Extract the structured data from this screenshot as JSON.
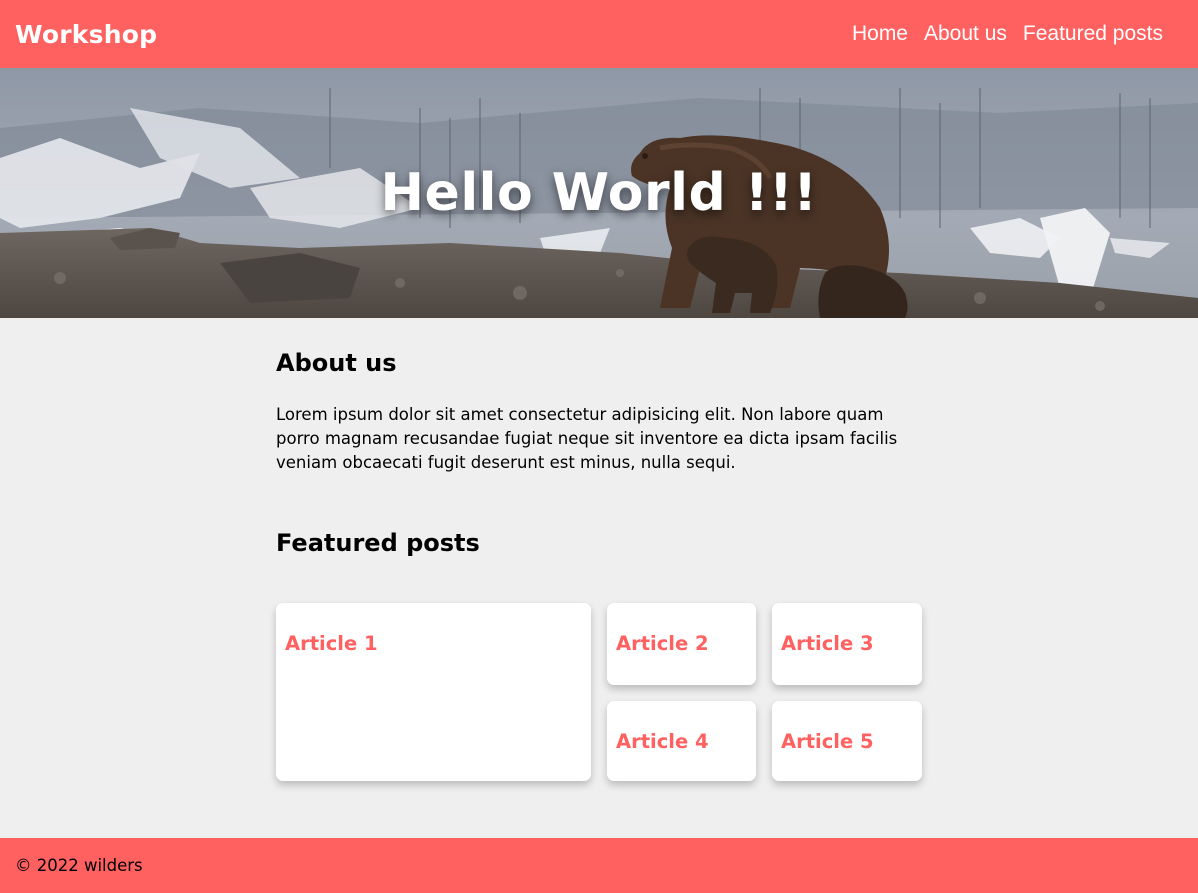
{
  "header": {
    "brand": "Workshop",
    "nav": [
      "Home",
      "About us",
      "Featured posts"
    ]
  },
  "hero": {
    "title": "Hello World !!!"
  },
  "about": {
    "title": "About us",
    "text": "Lorem ipsum dolor sit amet consectetur adipisicing elit. Non labore quam porro magnam recusandae fugiat neque sit inventore ea dicta ipsam facilis veniam obcaecati fugit deserunt est minus, nulla sequi."
  },
  "featured": {
    "title": "Featured posts",
    "articles": [
      "Article 1",
      "Article 2",
      "Article 3",
      "Article 4",
      "Article 5"
    ]
  },
  "footer": {
    "text": "© 2022 wilders"
  },
  "colors": {
    "accent": "#ff6060",
    "background": "#efefef",
    "card": "#ffffff"
  }
}
